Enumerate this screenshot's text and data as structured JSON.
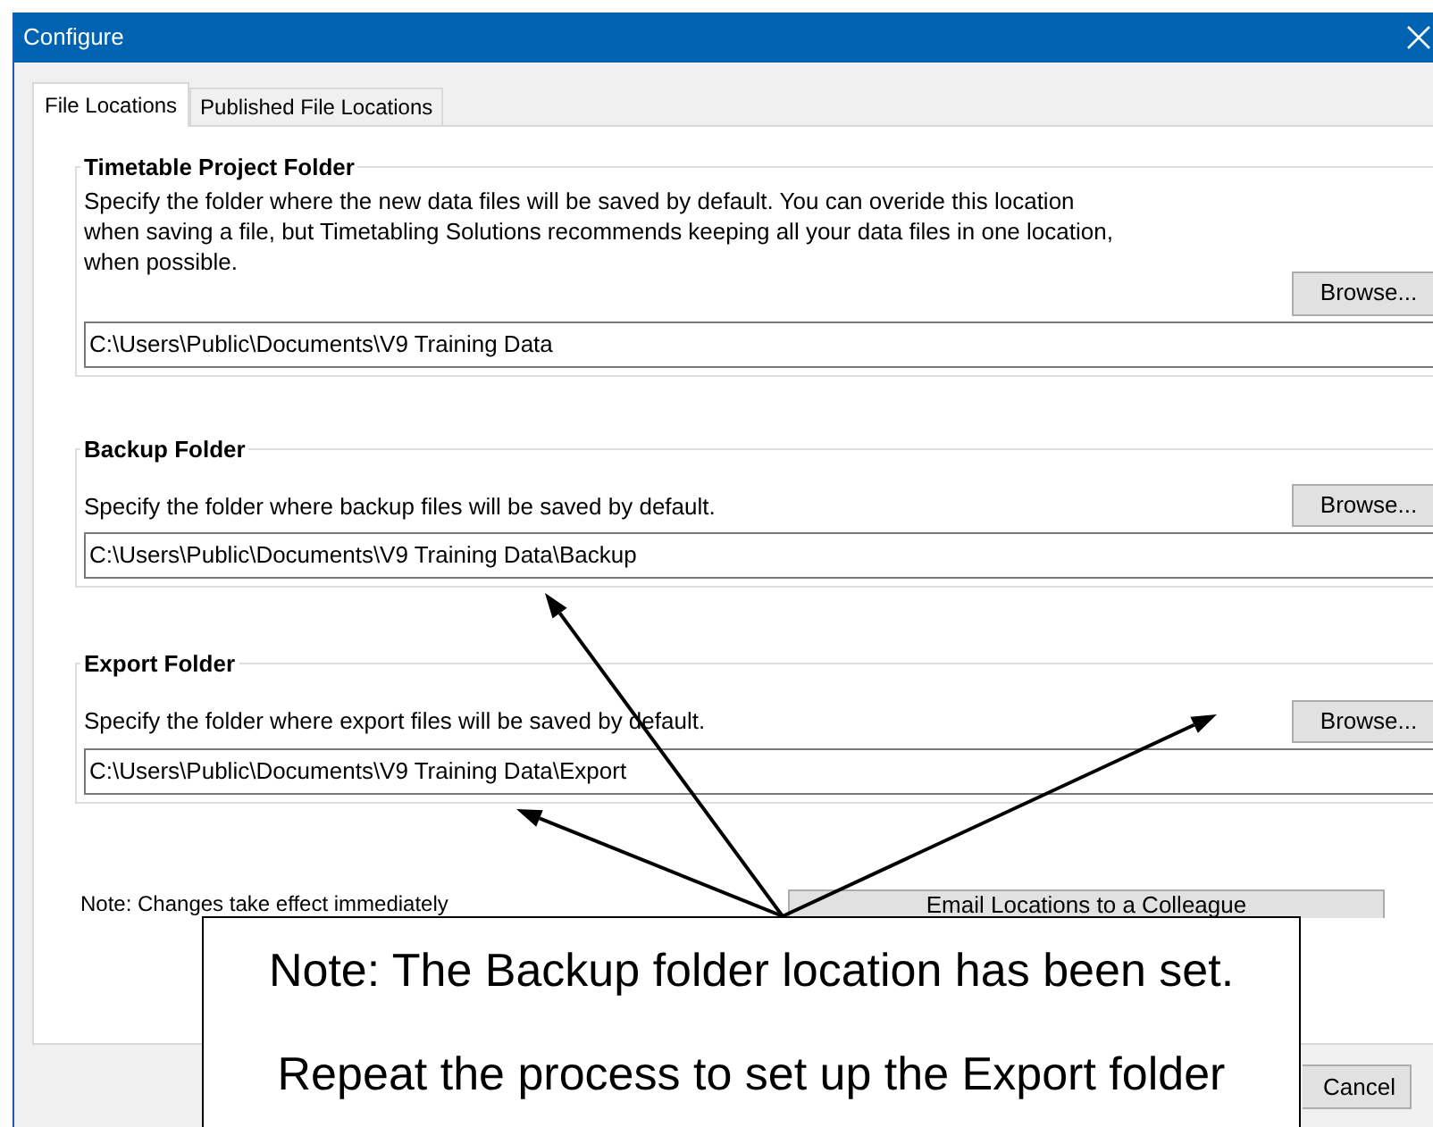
{
  "window": {
    "title": "Configure"
  },
  "tabs": [
    {
      "label": "File Locations",
      "selected": true
    },
    {
      "label": "Published File Locations",
      "selected": false
    }
  ],
  "groups": [
    {
      "title": "Timetable Project Folder",
      "description_lines": [
        "Specify the folder where the new data files will be saved by default. You can overide this location",
        "when saving a file, but Timetabling Solutions recommends keeping all your data files in one location,",
        "when possible."
      ],
      "button": "Browse...",
      "path": "C:\\Users\\Public\\Documents\\V9 Training Data"
    },
    {
      "title": "Backup Folder",
      "description_lines": [
        "Specify the folder where backup files will be saved by default."
      ],
      "button": "Browse...",
      "path": "C:\\Users\\Public\\Documents\\V9 Training Data\\Backup"
    },
    {
      "title": "Export Folder",
      "description_lines": [
        "Specify the folder where export files will be saved by default."
      ],
      "button": "Browse...",
      "path": "C:\\Users\\Public\\Documents\\V9 Training Data\\Export"
    }
  ],
  "note": "Note: Changes take effect immediately",
  "email_button": "Email Locations to a Colleague",
  "cancel_button": "Cancel",
  "callout": {
    "lines": [
      "Note:  The Backup folder location has been set.",
      "Repeat the process to set up the Export folder"
    ]
  }
}
